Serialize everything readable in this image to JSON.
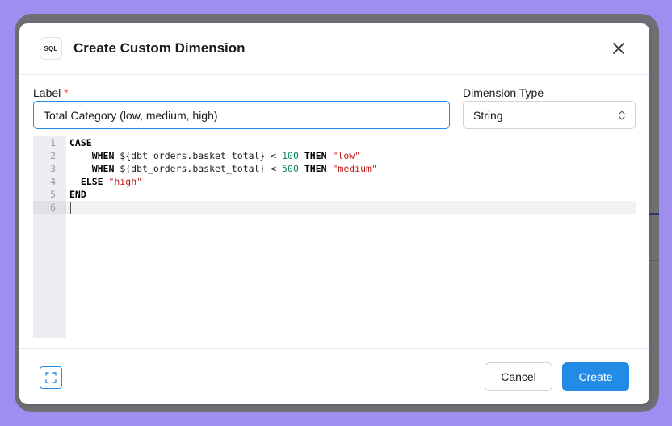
{
  "dialog": {
    "badge": "SQL",
    "title": "Create Custom Dimension"
  },
  "form": {
    "label_caption": "Label",
    "required_mark": "*",
    "label_value": "Total Category (low, medium, high)",
    "type_caption": "Dimension Type",
    "type_value": "String"
  },
  "editor": {
    "active_line": 6,
    "lines": [
      {
        "n": "1",
        "tokens": [
          {
            "t": "CASE",
            "c": "kw"
          }
        ]
      },
      {
        "n": "2",
        "tokens": [
          {
            "t": "    "
          },
          {
            "t": "WHEN",
            "c": "kw"
          },
          {
            "t": " ${dbt_orders.basket_total} < "
          },
          {
            "t": "100",
            "c": "num"
          },
          {
            "t": " "
          },
          {
            "t": "THEN",
            "c": "kw"
          },
          {
            "t": " "
          },
          {
            "t": "\"low\"",
            "c": "str"
          }
        ]
      },
      {
        "n": "3",
        "tokens": [
          {
            "t": "    "
          },
          {
            "t": "WHEN",
            "c": "kw"
          },
          {
            "t": " ${dbt_orders.basket_total} < "
          },
          {
            "t": "500",
            "c": "num"
          },
          {
            "t": " "
          },
          {
            "t": "THEN",
            "c": "kw"
          },
          {
            "t": " "
          },
          {
            "t": "\"medium\"",
            "c": "str"
          }
        ]
      },
      {
        "n": "4",
        "tokens": [
          {
            "t": "  "
          },
          {
            "t": "ELSE",
            "c": "kw"
          },
          {
            "t": " "
          },
          {
            "t": "\"high\"",
            "c": "str"
          }
        ]
      },
      {
        "n": "5",
        "tokens": [
          {
            "t": "END",
            "c": "kw"
          }
        ]
      },
      {
        "n": "6",
        "tokens": []
      }
    ]
  },
  "footer": {
    "cancel_label": "Cancel",
    "create_label": "Create"
  },
  "colors": {
    "accent": "#228be6",
    "keyword": "#000000",
    "number": "#098658",
    "string": "#c41a16"
  },
  "icons": {
    "close": "close-icon",
    "chevron": "chevron-up-down-icon",
    "expand": "expand-icon"
  }
}
